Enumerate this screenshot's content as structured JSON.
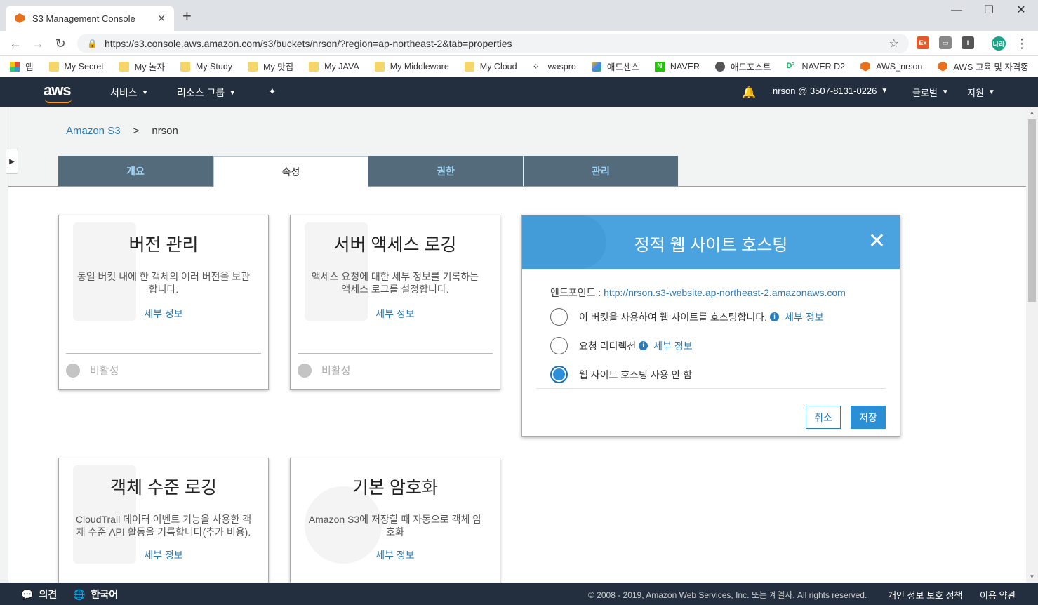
{
  "browser": {
    "tab_title": "S3 Management Console",
    "url": "https://s3.console.aws.amazon.com/s3/buckets/nrson/?region=ap-northeast-2&tab=properties",
    "bookmarks": [
      "앱",
      "My Secret",
      "My 놀자",
      "My Study",
      "My 맛집",
      "My JAVA",
      "My Middleware",
      "My Cloud",
      "waspro",
      "애드센스",
      "NAVER",
      "애드포스트",
      "NAVER D2",
      "AWS_nrson",
      "AWS 교육 및 자격증"
    ],
    "profile_label": "나라"
  },
  "awsnav": {
    "logo": "aws",
    "services": "서비스",
    "resource_groups": "리소스 그룹",
    "account": "nrson @ 3507-8131-0226",
    "region": "글로벌",
    "support": "지원"
  },
  "breadcrumb": {
    "root": "Amazon S3",
    "sep": ">",
    "bucket": "nrson"
  },
  "tabs": [
    "개요",
    "속성",
    "권한",
    "관리"
  ],
  "cards": [
    {
      "title": "버전 관리",
      "desc": "동일 버킷 내에 한 객체의 여러 버전을 보관합니다.",
      "more": "세부 정보",
      "status": "비활성"
    },
    {
      "title": "서버 액세스 로깅",
      "desc": "액세스 요청에 대한 세부 정보를 기록하는 액세스 로그를 설정합니다.",
      "more": "세부 정보",
      "status": "비활성"
    },
    {
      "title": "객체 수준 로깅",
      "desc": "CloudTrail 데이터 이벤트 기능을 사용한 객체 수준 API 활동을 기록합니다(추가 비용).",
      "more": "세부 정보"
    },
    {
      "title": "기본 암호화",
      "desc": "Amazon S3에 저장할 때 자동으로 객체 암호화",
      "more": "세부 정보"
    }
  ],
  "modal": {
    "title": "정적 웹 사이트 호스팅",
    "endpoint_label": "엔드포인트 :",
    "endpoint_url": "http://nrson.s3-website.ap-northeast-2.amazonaws.com",
    "options": [
      {
        "label": "이 버킷을 사용하여 웹 사이트를 호스팅합니다.",
        "more": "세부 정보",
        "checked": false
      },
      {
        "label": "요청 리디렉션",
        "more": "세부 정보",
        "checked": false
      },
      {
        "label": "웹 사이트 호스팅 사용 안 함",
        "checked": true
      }
    ],
    "cancel": "취소",
    "save": "저장"
  },
  "footer": {
    "feedback": "의견",
    "language": "한국어",
    "copyright": "© 2008 - 2019, Amazon Web Services, Inc. 또는 계열사. All rights reserved.",
    "privacy": "개인 정보 보호 정책",
    "terms": "이용 약관"
  }
}
